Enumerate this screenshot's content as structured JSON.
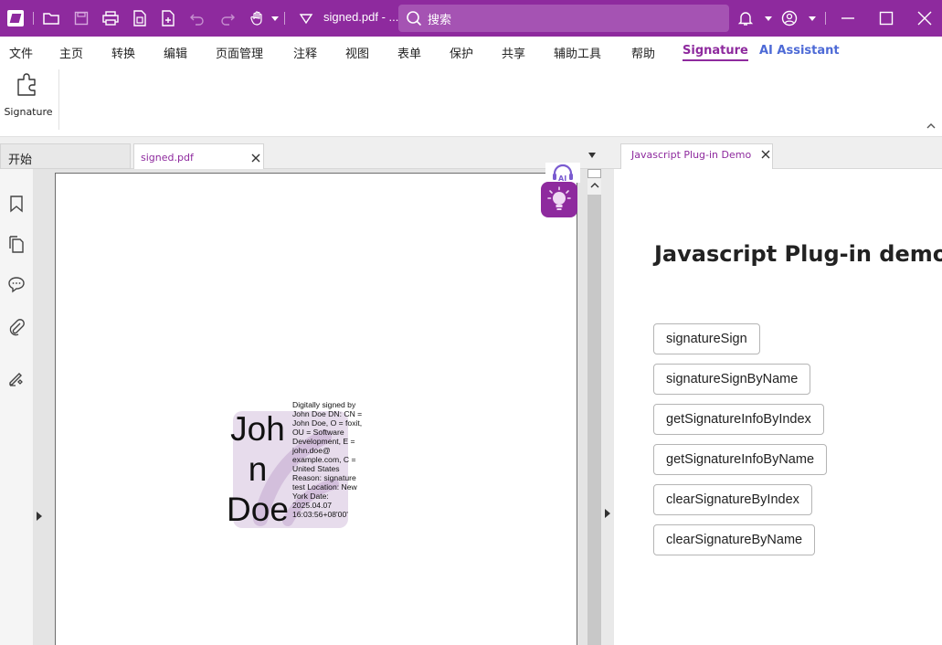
{
  "titlebar": {
    "document_title": "signed.pdf - ...",
    "search_placeholder": "搜索"
  },
  "menu": {
    "items": [
      "文件",
      "主页",
      "转换",
      "编辑",
      "页面管理",
      "注释",
      "视图",
      "表单",
      "保护",
      "共享",
      "辅助工具",
      "帮助"
    ],
    "active_item": "Signature",
    "ai_item": "AI Assistant"
  },
  "ribbon": {
    "signature_label": "Signature"
  },
  "tabs": {
    "start_label": "开始",
    "doc_label": "signed.pdf"
  },
  "signature_stamp": {
    "name_lines": [
      "Joh",
      "n",
      "Doe"
    ],
    "details": "Digitally signed by John Doe DN: CN = John Doe, O = foxit, OU = Software Development, E = john.doe@ example.com, C = United States Reason: signature test Location: New York Date: 2025.04.07 16:03:56+08'00'"
  },
  "right_panel": {
    "tab_label": "Javascript Plug-in Demo",
    "heading": "Javascript Plug-in demo",
    "buttons": [
      "signatureSign",
      "signatureSignByName",
      "getSignatureInfoByIndex",
      "getSignatureInfoByName",
      "clearSignatureByIndex",
      "clearSignatureByName"
    ]
  },
  "colors": {
    "brand": "#8e2a9e",
    "ai_accent": "#4d6ad6"
  }
}
